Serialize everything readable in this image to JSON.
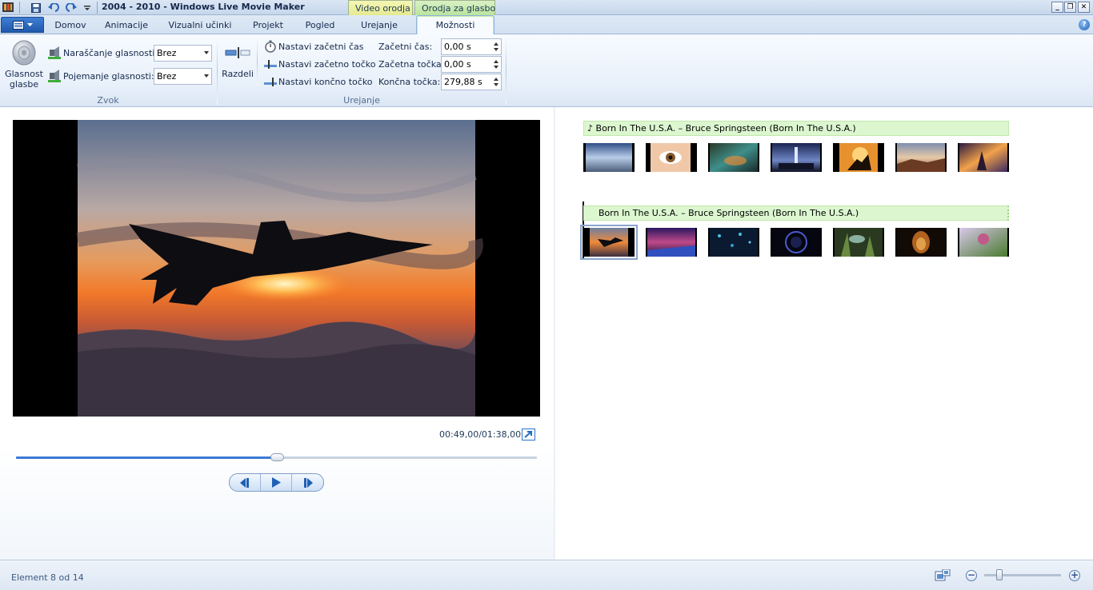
{
  "window": {
    "title": "2004 - 2010 - Windows Live Movie Maker",
    "context_tabs": {
      "video_tools": "Video orodja",
      "music_tools": "Orodja za glasbo"
    },
    "controls": {
      "minimize": "_",
      "restore": "❐",
      "close": "✕"
    }
  },
  "tabs": [
    {
      "label": "Domov",
      "active": false
    },
    {
      "label": "Animacije",
      "active": false
    },
    {
      "label": "Vizualni učinki",
      "active": false
    },
    {
      "label": "Projekt",
      "active": false
    },
    {
      "label": "Pogled",
      "active": false
    },
    {
      "label": "Urejanje",
      "active": false
    },
    {
      "label": "Možnosti",
      "active": true
    }
  ],
  "ribbon": {
    "audio": {
      "music_volume_label": "Glasnost glasbe",
      "fade_in_label": "Naraščanje glasnosti:",
      "fade_in_value": "Brez",
      "fade_out_label": "Pojemanje glasnosti:",
      "fade_out_value": "Brez",
      "group_label": "Zvok"
    },
    "edit": {
      "split_label": "Razdeli",
      "set_start_time": "Nastavi začetni čas",
      "set_start_point": "Nastavi začetno točko",
      "set_end_point": "Nastavi končno točko",
      "start_time_label": "Začetni čas:",
      "start_time_value": "0,00 s",
      "start_point_label": "Začetna točka:",
      "start_point_value": "0,00 s",
      "end_point_label": "Končna točka:",
      "end_point_value": "279,88 s",
      "group_label": "Urejanje"
    }
  },
  "preview": {
    "time": "00:49,00/01:38,00",
    "progress": 0.5
  },
  "storyboard": {
    "music_track_1": "Born In The U.S.A. – Bruce Springsteen (Born In The U.S.A.)",
    "music_track_2": "Born In The U.S.A. – Bruce Springsteen (Born In The U.S.A.)",
    "selected_index": 7,
    "total_items": 14
  },
  "status": {
    "text": "Element 8 od 14",
    "zoom_level": 0.2
  },
  "colors": {
    "accent": "#1f58ac",
    "music_bar": "#dcf7d0",
    "seek_fill": "#3a7ad6"
  },
  "icons": [
    "app-menu-icon",
    "save-icon",
    "undo-icon",
    "redo-icon",
    "help-icon",
    "speaker-icon",
    "fade-in-icon",
    "fade-out-icon",
    "split-icon",
    "stopwatch-icon",
    "start-point-icon",
    "end-point-icon",
    "fullscreen-icon",
    "previous-frame-icon",
    "play-icon",
    "next-frame-icon",
    "zoom-out-icon",
    "zoom-in-icon",
    "thumbnail-size-icon",
    "music-note-icon"
  ]
}
